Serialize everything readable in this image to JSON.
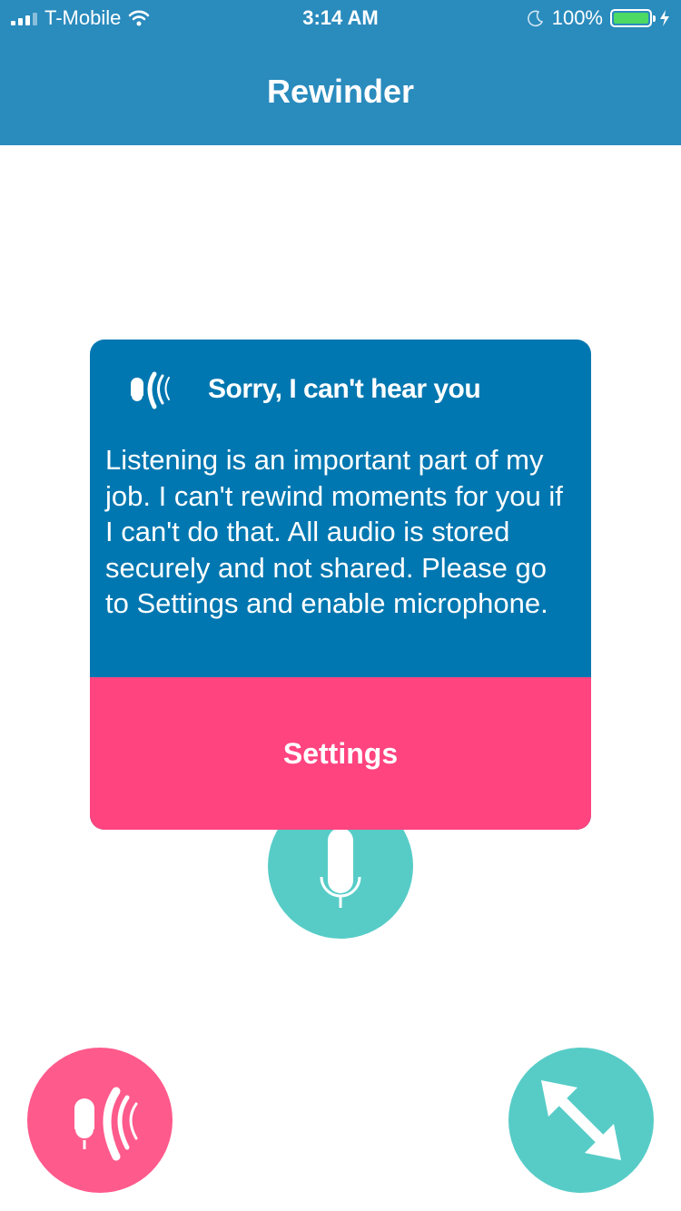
{
  "status_bar": {
    "carrier": "T-Mobile",
    "time": "3:14 AM",
    "battery": "100%",
    "icons": [
      "signal-icon",
      "wifi-icon",
      "moon-icon",
      "battery-icon",
      "charging-icon"
    ]
  },
  "nav": {
    "title": "Rewinder"
  },
  "dialog": {
    "title": "Sorry, I can't hear you",
    "message": "Listening is an important part of my job. I can't rewind moments for you if I can't do that. All audio is stored securely and not shared. Please go to Settings and enable microphone.",
    "button_label": "Settings"
  },
  "colors": {
    "header": "#2a8bbd",
    "dialog": "#0077b0",
    "accent_pink": "#ff4480",
    "fab_pink": "#ff5a8c",
    "teal": "#57ccc7",
    "battery_green": "#4cd964"
  }
}
